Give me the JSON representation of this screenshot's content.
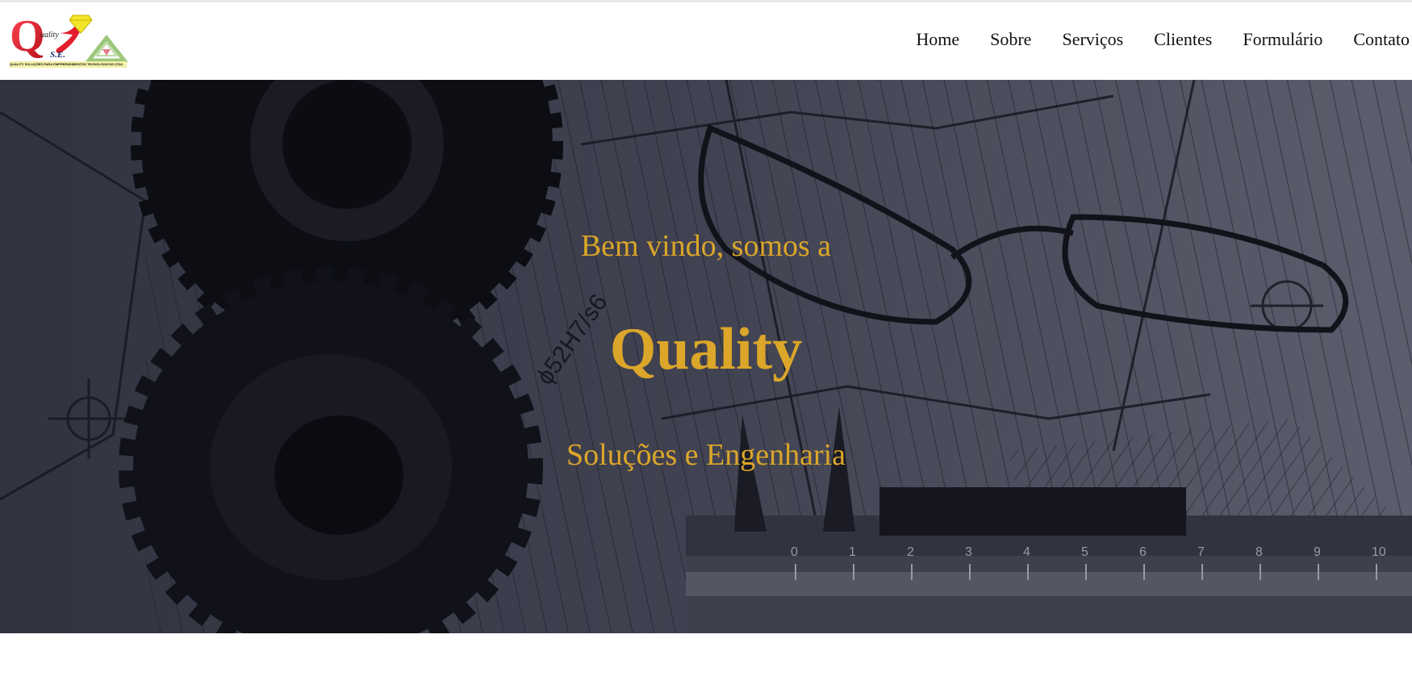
{
  "brand": {
    "logo_letter": "Q",
    "logo_small": "uality",
    "logo_initials": "S.E.",
    "logo_caption": "QUALITY SOLUÇÕES PARA EMPREENDIMENTOS TECNOLÓGICOS LTDA",
    "colors": {
      "red": "#e21d2c",
      "yellow": "#f2e52a",
      "green": "#9bc77a",
      "gold": "#dba629"
    }
  },
  "nav": {
    "items": [
      {
        "label": "Home"
      },
      {
        "label": "Sobre"
      },
      {
        "label": "Serviços"
      },
      {
        "label": "Clientes"
      },
      {
        "label": "Formulário"
      },
      {
        "label": "Contato"
      }
    ]
  },
  "hero": {
    "welcome": "Bem vindo, somos a",
    "title": "Quality",
    "subtitle": "Soluções e Engenharia",
    "background": "gears-blueprint-glasses-caliper-photo",
    "drawing_label": "ϕ52H7/s6",
    "ruler_numbers": [
      "0",
      "1",
      "2",
      "3",
      "4",
      "5",
      "6",
      "7",
      "8",
      "9",
      "10"
    ]
  }
}
